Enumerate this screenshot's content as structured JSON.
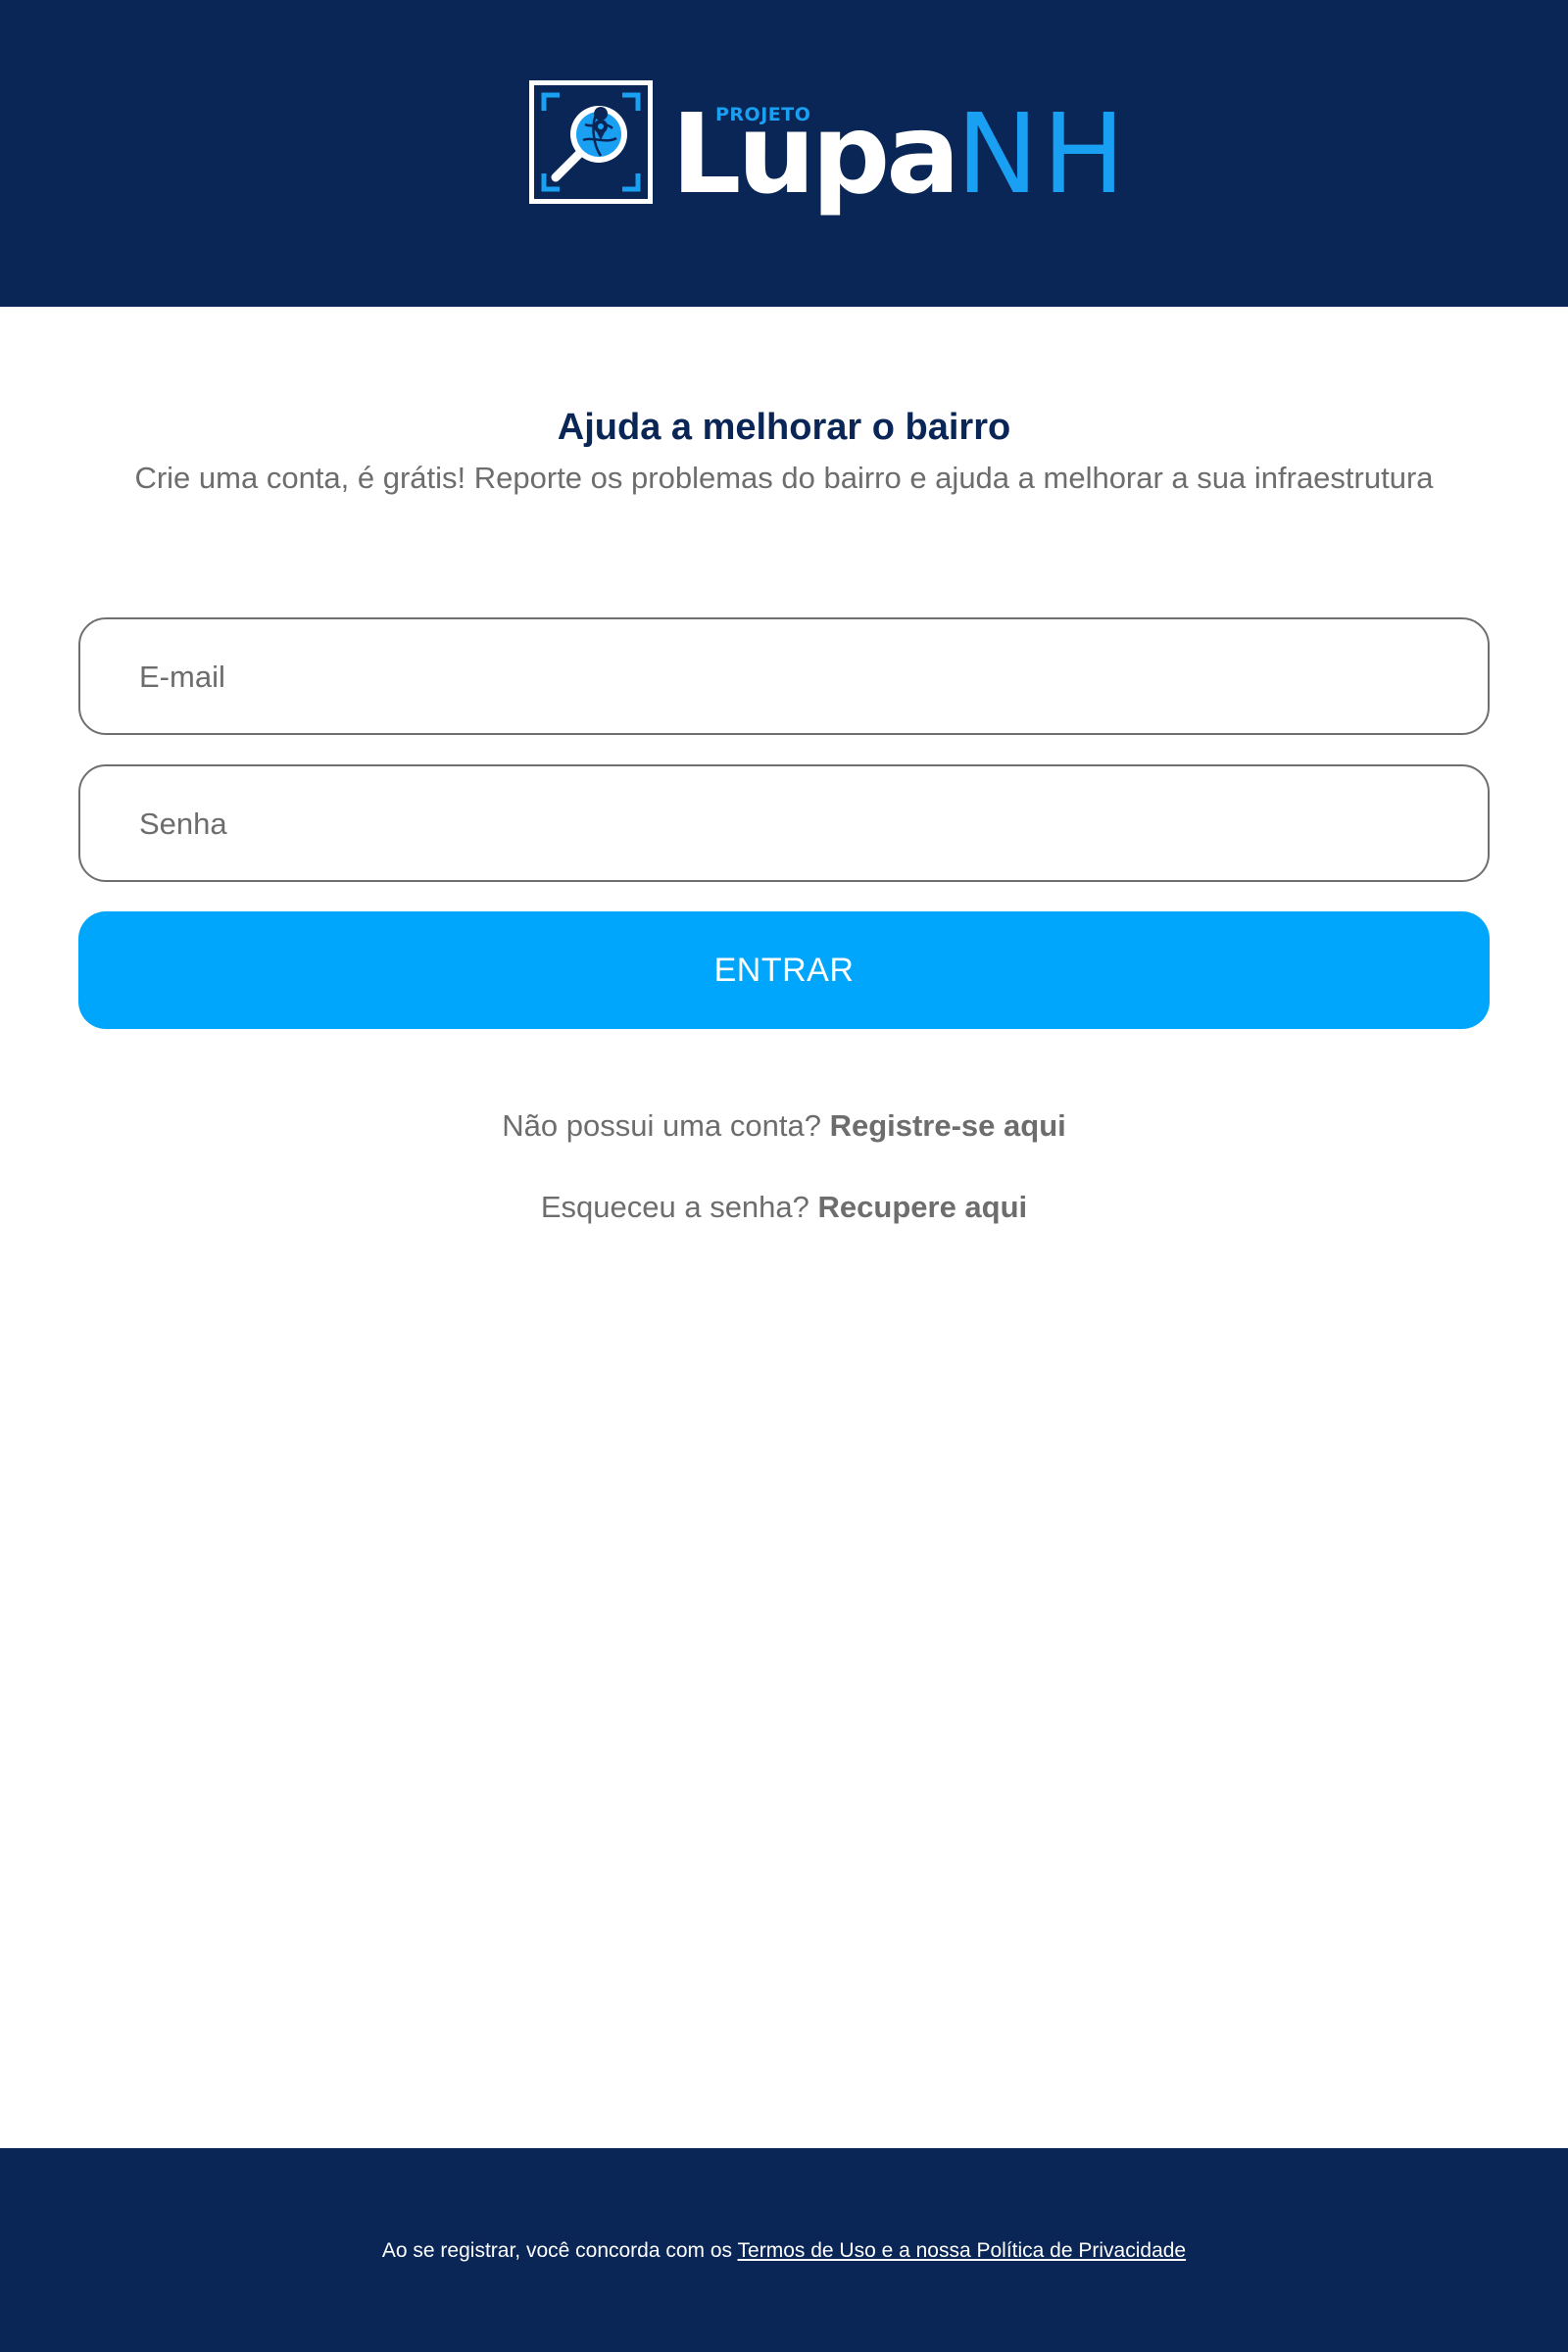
{
  "header": {
    "logo": {
      "small_text": "PROJETO",
      "word_main": "Lupa",
      "word_accent": "NH",
      "icon": "magnifier-globe-icon"
    }
  },
  "main": {
    "title": "Ajuda a melhorar o bairro",
    "subtitle": "Crie uma conta, é grátis! Reporte os problemas do bairro e ajuda a melhorar a sua infraestrutura",
    "email": {
      "placeholder": "E-mail",
      "value": ""
    },
    "password": {
      "placeholder": "Senha",
      "value": ""
    },
    "submit_label": "ENTRAR",
    "register": {
      "prompt": "Não possui uma conta?",
      "link": "Registre-se aqui"
    },
    "recover": {
      "prompt": "Esqueceu a senha?",
      "link": "Recupere aqui"
    }
  },
  "footer": {
    "text": "Ao se registrar, você concorda com os",
    "link": "Termos de Uso e a nossa Política de Privacidade"
  },
  "colors": {
    "navy": "#0a2656",
    "accent": "#00a6fb",
    "logo_blue": "#1aa0f2",
    "text_gray": "#6d6d6d"
  }
}
